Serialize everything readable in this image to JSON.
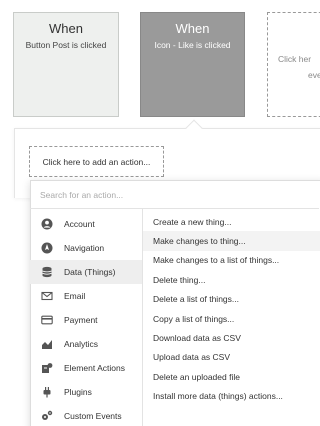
{
  "events": [
    {
      "title": "When",
      "subtitle": "Button Post is clicked"
    },
    {
      "title": "When",
      "subtitle": "Icon - Like is clicked"
    }
  ],
  "ghost_card": {
    "line1": "Click her",
    "line2": "eve"
  },
  "add_action_label": "Click here to add an action...",
  "search": {
    "placeholder": "Search for an action..."
  },
  "categories": [
    {
      "label": "Account",
      "icon": "account-icon"
    },
    {
      "label": "Navigation",
      "icon": "navigation-icon"
    },
    {
      "label": "Data (Things)",
      "icon": "database-icon"
    },
    {
      "label": "Email",
      "icon": "email-icon"
    },
    {
      "label": "Payment",
      "icon": "payment-icon"
    },
    {
      "label": "Analytics",
      "icon": "analytics-icon"
    },
    {
      "label": "Element Actions",
      "icon": "element-actions-icon"
    },
    {
      "label": "Plugins",
      "icon": "plugins-icon"
    },
    {
      "label": "Custom Events",
      "icon": "custom-events-icon"
    }
  ],
  "selected_category": "Data (Things)",
  "actions": [
    "Create a new thing...",
    "Make changes to thing...",
    "Make changes to a list of things...",
    "Delete thing...",
    "Delete a list of things...",
    "Copy a list of things...",
    "Download data as CSV",
    "Upload data as CSV",
    "Delete an uploaded file",
    "Install more data (things) actions..."
  ]
}
